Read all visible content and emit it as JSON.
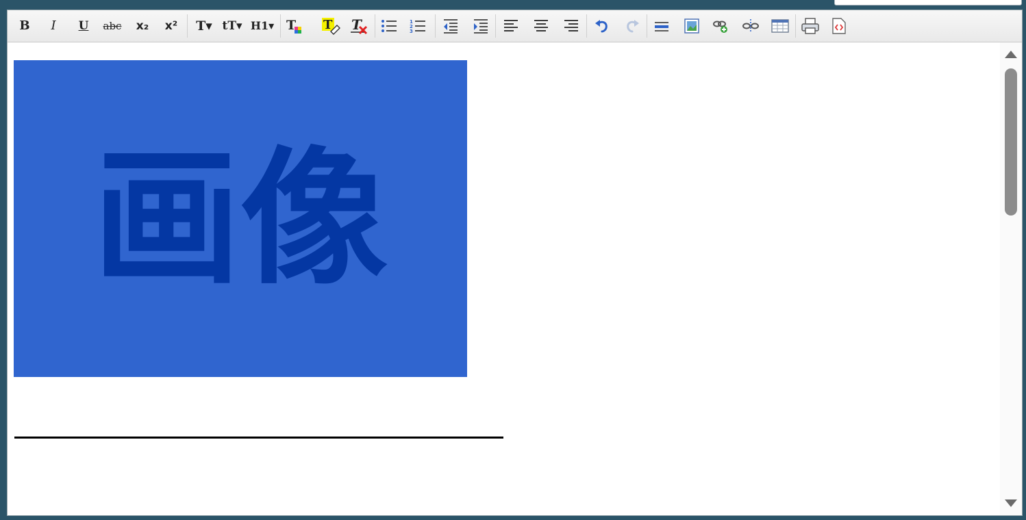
{
  "toolbar": {
    "buttons": [
      {
        "name": "bold",
        "glyph": "B"
      },
      {
        "name": "italic",
        "glyph": "I"
      },
      {
        "name": "underline",
        "glyph": "U"
      },
      {
        "name": "strikethrough",
        "glyph": "abc"
      },
      {
        "name": "subscript",
        "glyph": "x₂"
      },
      {
        "name": "superscript",
        "glyph": "x²"
      },
      {
        "name": "font-family",
        "glyph": "T▾"
      },
      {
        "name": "font-size",
        "glyph": "tT▾"
      },
      {
        "name": "heading",
        "glyph": "H1▾"
      },
      {
        "name": "text-color",
        "glyph": "T"
      },
      {
        "name": "highlight",
        "glyph": "T"
      },
      {
        "name": "clear-format",
        "glyph": "T"
      }
    ]
  },
  "content": {
    "image_text": "画像"
  },
  "colors": {
    "image_bg": "#3065cf",
    "image_text": "#0437a3",
    "window_bg": "#2b5468"
  }
}
